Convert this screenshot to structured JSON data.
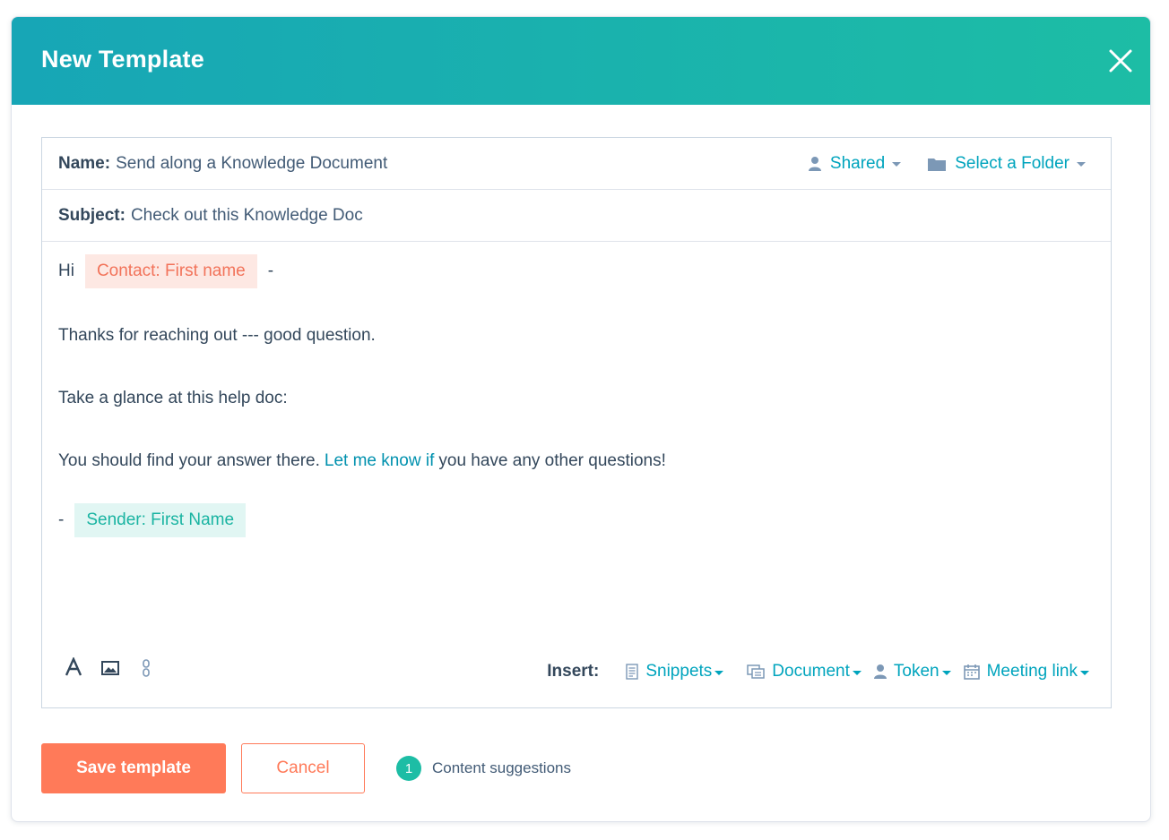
{
  "modal": {
    "title": "New Template"
  },
  "fields": {
    "name_label": "Name:",
    "name_value": "Send along a Knowledge Document",
    "subject_label": "Subject:",
    "subject_value": "Check out this Knowledge Doc",
    "sharing": "Shared",
    "folder": "Select a Folder"
  },
  "body": {
    "greeting": "Hi",
    "contact_token": "Contact: First name",
    "greeting_suffix": "-",
    "line2": "Thanks for reaching out --- good question.",
    "line3": "Take a glance at this help doc:",
    "line4_before": "You should find your answer there.",
    "line4_link": "Let me know if",
    "line4_after": "you have any other questions!",
    "signoff_prefix": "-",
    "sender_token": "Sender: First Name"
  },
  "toolbar": {
    "insert_label": "Insert:",
    "snippets": "Snippets",
    "document": "Document",
    "token": "Token",
    "meeting_link": "Meeting link"
  },
  "footer": {
    "save": "Save template",
    "cancel": "Cancel",
    "suggestion_count": "1",
    "suggestion_label": "Content suggestions"
  },
  "colors": {
    "header_start": "#17a6b6",
    "header_end": "#1dbda5",
    "primary_orange": "#ff7a59",
    "link_teal": "#00a4bd",
    "contact_token_bg": "#fde8e3",
    "sender_token_bg": "#e1f6f3"
  }
}
